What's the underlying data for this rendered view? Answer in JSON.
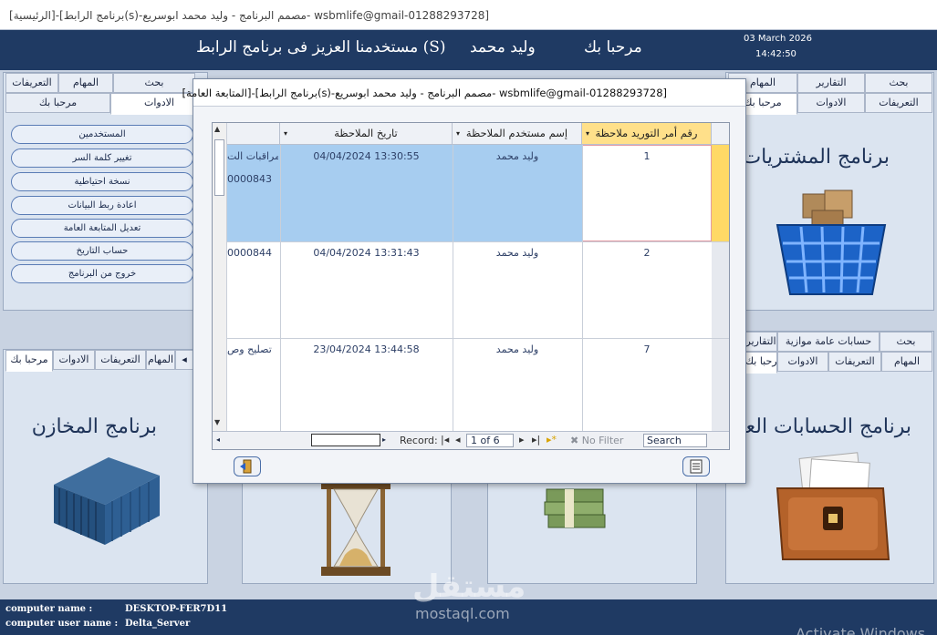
{
  "window_title": "[الرئيسية]-[برنامج الرابط(s)-مصمم البرنامج - وليد محمد ابوسريع- wsbmlife@gmail-01288293728]",
  "header": {
    "welcome_label": "مرحبا بك",
    "user_name": "وليد محمد",
    "greeting": "مستخدمنا العزيز فى برنامج الرابط (S)",
    "date": "03 March 2026",
    "time": "14:42:50"
  },
  "top_left_panel": {
    "tabs_row1": [
      "بحث",
      "المهام",
      "التعريفات"
    ],
    "tabs_row2": [
      "الادوات",
      "مرحبا بك"
    ],
    "buttons": [
      "المستخدمين",
      "تغيير كلمة السر",
      "نسخة احتياطية",
      "اعادة ربط البيانات",
      "تعديل المتابعة العامة",
      "حساب التاريخ",
      "خروج من البرنامج"
    ]
  },
  "top_right_panel": {
    "tabs_row1": [
      "بحث",
      "التقارير",
      "المهام"
    ],
    "tabs_row2": [
      "التعريفات",
      "الادوات",
      "مرحبا بك"
    ],
    "title": "برنامج المشتريات",
    "icon": "shopping-basket-icon"
  },
  "bottom_left_panel": {
    "tabs": [
      "المهام",
      "التعريفات",
      "الادوات",
      "مرحبا بك"
    ],
    "title": "برنامج المخازن",
    "icon": "shipping-container-icon"
  },
  "bottom_right_panel": {
    "tabs_row1": [
      "بحث",
      "حسابات عامة موازية",
      "التقارير"
    ],
    "tabs_row2": [
      "المهام",
      "التعريفات",
      "الادوات",
      "مرحبا بك"
    ],
    "title": "برنامج الحسابات العامة",
    "icon": "briefcase-icon"
  },
  "bottom_center_panels": [
    {
      "icon": "hourglass-icon"
    },
    {
      "icon": "money-stack-icon"
    }
  ],
  "dialog": {
    "title": "[المتابعة العامة]-[برنامج الرابط(s)-مصمم البرنامج - وليد محمد ابوسريع- wsbmlife@gmail-01288293728]",
    "columns": [
      "رقم أمر التوريد ملاحظة",
      "إسم مستخدم الملاحظة",
      "تاريخ الملاحظة"
    ],
    "rows": [
      {
        "order_no": "1",
        "user": "وليد محمد",
        "date": "04/04/2024 13:30:55",
        "note_line1": "مراقبات الت",
        "note_line2": "0000843"
      },
      {
        "order_no": "2",
        "user": "وليد محمد",
        "date": "04/04/2024 13:31:43",
        "note_line1": "0000844",
        "note_line2": ""
      },
      {
        "order_no": "7",
        "user": "وليد محمد",
        "date": "23/04/2024 13:44:58",
        "note_line1": "تصليح وص",
        "note_line2": ""
      }
    ],
    "nav": {
      "record_label": "Record:",
      "position": "1 of 6",
      "filter_label": "No Filter",
      "search_label": "Search"
    },
    "buttons": {
      "exit_icon": "exit-door-icon",
      "report_icon": "report-icon"
    }
  },
  "footer": {
    "computer_name_label": "computer name :",
    "computer_name": "DESKTOP-FER7D11",
    "computer_user_label": "computer user name :",
    "computer_user": "Delta_Server"
  },
  "watermark": {
    "arabic": "مستقل",
    "latin": "mostaql.com",
    "activate": "Activate Windows"
  }
}
